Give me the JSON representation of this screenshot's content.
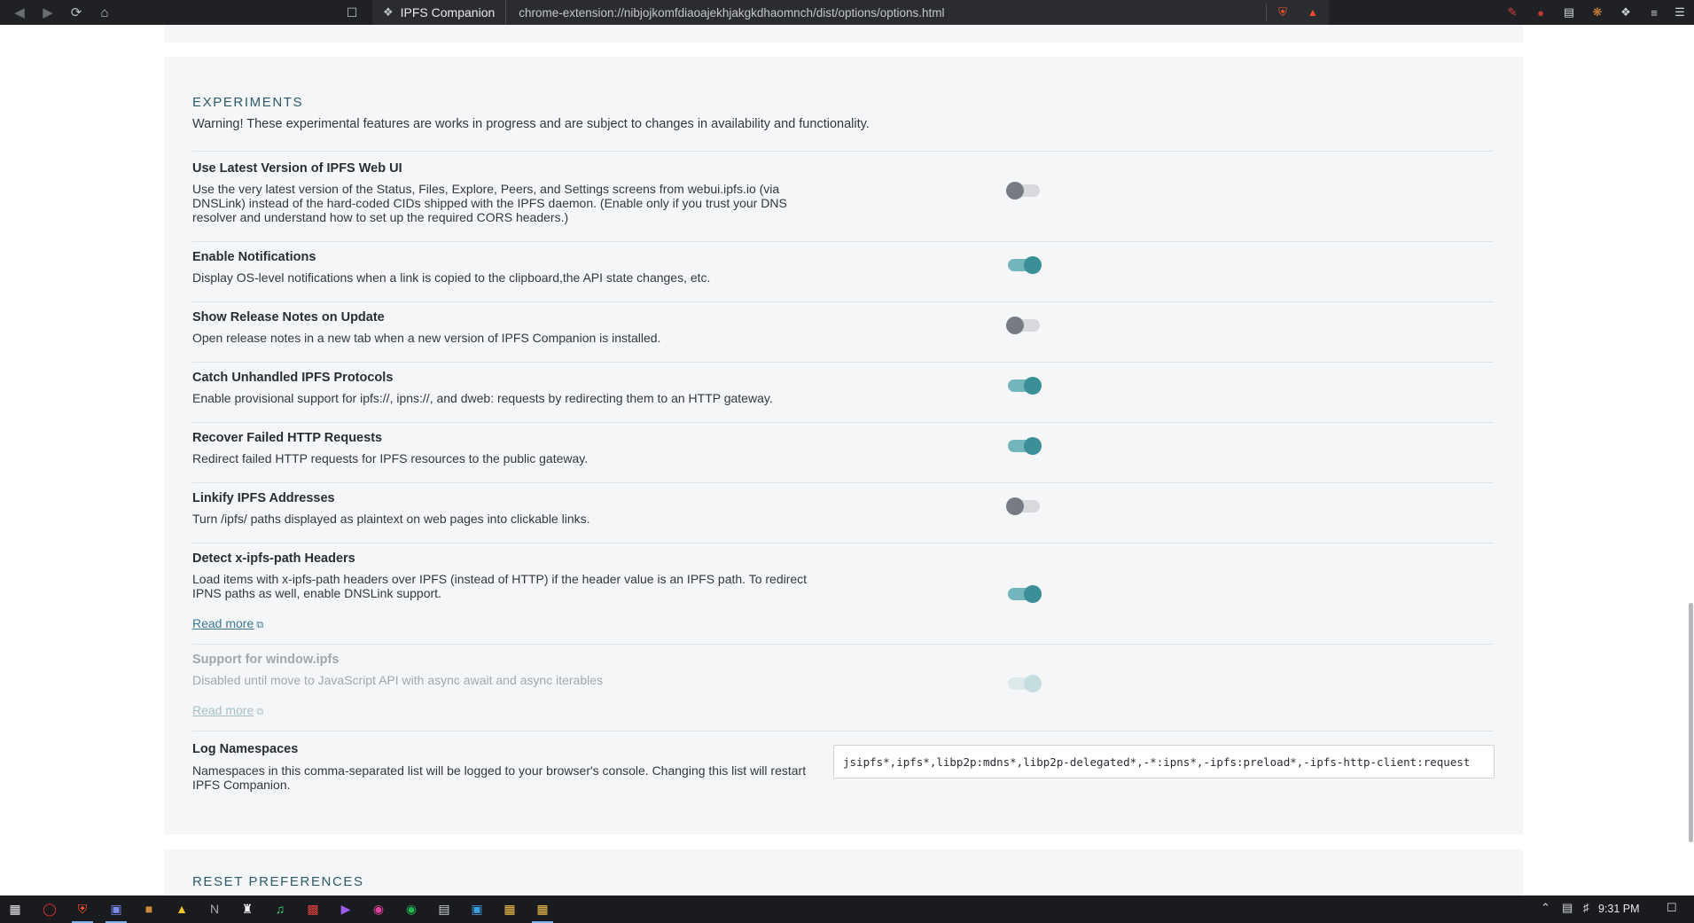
{
  "browser": {
    "tab_title": "IPFS Companion",
    "url": "chrome-extension://nibjojkomfdiaoajekhjakgkdhaomnch/dist/options/options.html"
  },
  "experiments": {
    "section_title": "EXPERIMENTS",
    "warning": "Warning! These experimental features are works in progress and are subject to changes in availability and functionality.",
    "options": [
      {
        "title": "Use Latest Version of IPFS Web UI",
        "desc": "Use the very latest version of the Status, Files, Explore, Peers, and Settings screens from webui.ipfs.io (via DNSLink) instead of the hard-coded CIDs shipped with the IPFS daemon. (Enable only if you trust your DNS resolver and understand how to set up the required CORS headers.)",
        "enabled": false
      },
      {
        "title": "Enable Notifications",
        "desc": "Display OS-level notifications when a link is copied to the clipboard,the API state changes, etc.",
        "enabled": true
      },
      {
        "title": "Show Release Notes on Update",
        "desc": "Open release notes in a new tab when a new version of IPFS Companion is installed.",
        "enabled": false
      },
      {
        "title": "Catch Unhandled IPFS Protocols",
        "desc": "Enable provisional support for ipfs://, ipns://, and dweb: requests by redirecting them to an HTTP gateway.",
        "enabled": true
      },
      {
        "title": "Recover Failed HTTP Requests",
        "desc": "Redirect failed HTTP requests for IPFS resources to the public gateway.",
        "enabled": true
      },
      {
        "title": "Linkify IPFS Addresses",
        "desc": "Turn /ipfs/ paths displayed as plaintext on web pages into clickable links.",
        "enabled": false
      },
      {
        "title": "Detect x-ipfs-path Headers",
        "desc": "Load items with x-ipfs-path headers over IPFS (instead of HTTP) if the header value is an IPFS path. To redirect IPNS paths as well, enable DNSLink support.",
        "link": "Read more",
        "enabled": true
      },
      {
        "title": "Support for window.ipfs",
        "desc": "Disabled until move to JavaScript API with async await and async iterables",
        "link": "Read more",
        "enabled": true,
        "disabled": true
      },
      {
        "title": "Log Namespaces",
        "desc": "Namespaces in this comma-separated list will be logged to your browser's console. Changing this list will restart IPFS Companion.",
        "value": "jsipfs*,ipfs*,libp2p:mdns*,libp2p-delegated*,-*:ipns*,-ipfs:preload*,-ipfs-http-client:request"
      }
    ]
  },
  "reset": {
    "section_title": "RESET PREFERENCES"
  },
  "taskbar": {
    "clock": "9:31 PM"
  },
  "colors": {
    "toggle_on": "#3a8f99",
    "toggle_off": "#777b84",
    "link": "#3d7a91",
    "section_title": "#2e5a6a"
  }
}
